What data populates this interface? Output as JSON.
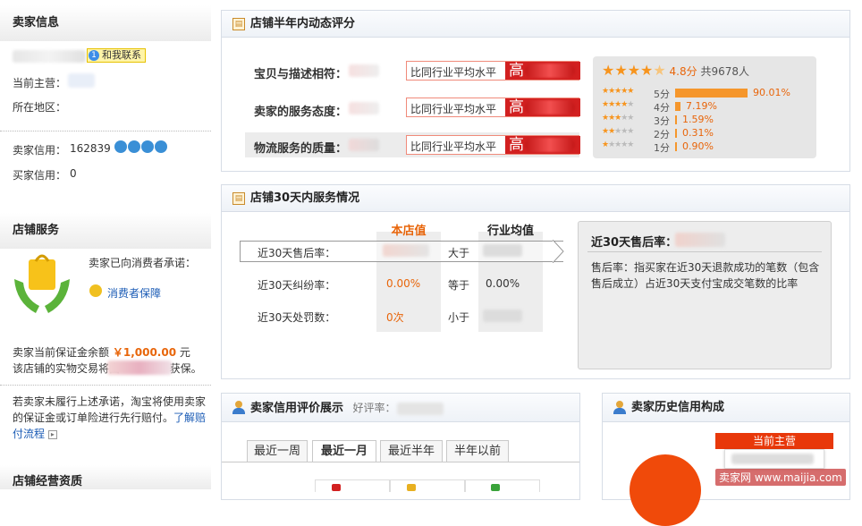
{
  "sidebar": {
    "seller_info_title": "卖家信息",
    "contact_btn": "和我联系",
    "main_business_label": "当前主营：",
    "location_label": "所在地区：",
    "seller_credit_label": "卖家信用：",
    "seller_credit_value": "162839",
    "buyer_credit_label": "买家信用：",
    "buyer_credit_value": "0",
    "store_service_title": "店铺服务",
    "promise_text": "卖家已向消费者承诺：",
    "guarantee_link": "消费者保障",
    "deposit_prefix": "卖家当前保证金余额",
    "deposit_amount": "￥1,000.00",
    "deposit_unit": "元",
    "deposit_line2_start": "该店铺的实物交易将由",
    "deposit_line2_end": "获保。",
    "penalty_text": "若卖家未履行上述承诺，淘宝将使用卖家的保证金或订单险进行先行赔付。",
    "learn_link": "了解赔付流程",
    "qualification_title": "店铺经营资质"
  },
  "rating_panel": {
    "title": "店铺半年内动态评分",
    "rows": [
      {
        "label": "宝贝与描述相符：",
        "compare": "比同行业平均水平",
        "level": "高"
      },
      {
        "label": "卖家的服务态度：",
        "compare": "比同行业平均水平",
        "level": "高"
      },
      {
        "label": "物流服务的质量：",
        "compare": "比同行业平均水平",
        "level": "高"
      }
    ],
    "score": "4.8分",
    "total": "共9678人",
    "dist": [
      {
        "label": "5分",
        "pct": "90.01%",
        "value": 90.01
      },
      {
        "label": "4分",
        "pct": "7.19%",
        "value": 7.19
      },
      {
        "label": "3分",
        "pct": "1.59%",
        "value": 1.59
      },
      {
        "label": "2分",
        "pct": "0.31%",
        "value": 0.31
      },
      {
        "label": "1分",
        "pct": "0.90%",
        "value": 0.9
      }
    ]
  },
  "service_panel": {
    "title": "店铺30天内服务情况",
    "col_store": "本店值",
    "col_avg": "行业均值",
    "rows": [
      {
        "label": "近30天售后率：",
        "store": "",
        "cmp": "大于",
        "avg": ""
      },
      {
        "label": "近30天纠纷率：",
        "store": "0.00%",
        "cmp": "等于",
        "avg": "0.00%"
      },
      {
        "label": "近30天处罚数：",
        "store": "0次",
        "cmp": "小于",
        "avg": ""
      }
    ],
    "detail_title": "近30天售后率：",
    "detail_text": "售后率：指买家在近30天退款成功的笔数（包含售后成立）占近30天支付宝成交笔数的比率"
  },
  "credit_panel": {
    "title": "卖家信用评价展示",
    "good_rate_label": "好评率：",
    "tabs": [
      "最近一周",
      "最近一月",
      "最近半年",
      "半年以前"
    ]
  },
  "history_panel": {
    "title": "卖家历史信用构成",
    "current_main": "当前主营"
  },
  "watermark": "卖家网 www.maijia.com"
}
